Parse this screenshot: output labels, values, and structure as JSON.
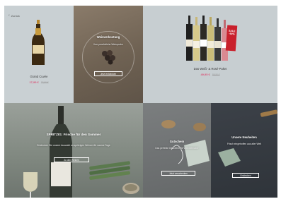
{
  "header": {
    "back_label": "Zurück"
  },
  "tiles": {
    "champagne": {
      "product_name": "Grand Cuvée",
      "price": "17,99 €",
      "old_price": "22,90 €"
    },
    "tasting": {
      "title": "Weinverkostung",
      "subtitle": "Ihre persönliche Weinprobe",
      "cta": "Jetzt entdecken"
    },
    "bundle": {
      "product_name": "Das Weiß- & Rosé-Paket",
      "price": "49,95 €",
      "old_price": "89,50 €",
      "badge": "SALE -44%"
    },
    "sparkling": {
      "title": "SPRITZIG: Frische für den Sommer",
      "subtitle": "Entdecken Sie unsere Auswahl an spritzigen Weinen für warme Tage",
      "cta": "Zu den Weinen"
    },
    "gift": {
      "title": "Gutschein",
      "subtitle": "Das perfekte Geschenk für Weinliebhaber",
      "cta": "Jetzt verschenken"
    },
    "news": {
      "title": "Unsere Neuheiten",
      "subtitle": "Frisch eingetroffen aus aller Welt",
      "cta": "Entdecken"
    }
  },
  "colors": {
    "price": "#d9567a",
    "badge": "#c9202c"
  }
}
